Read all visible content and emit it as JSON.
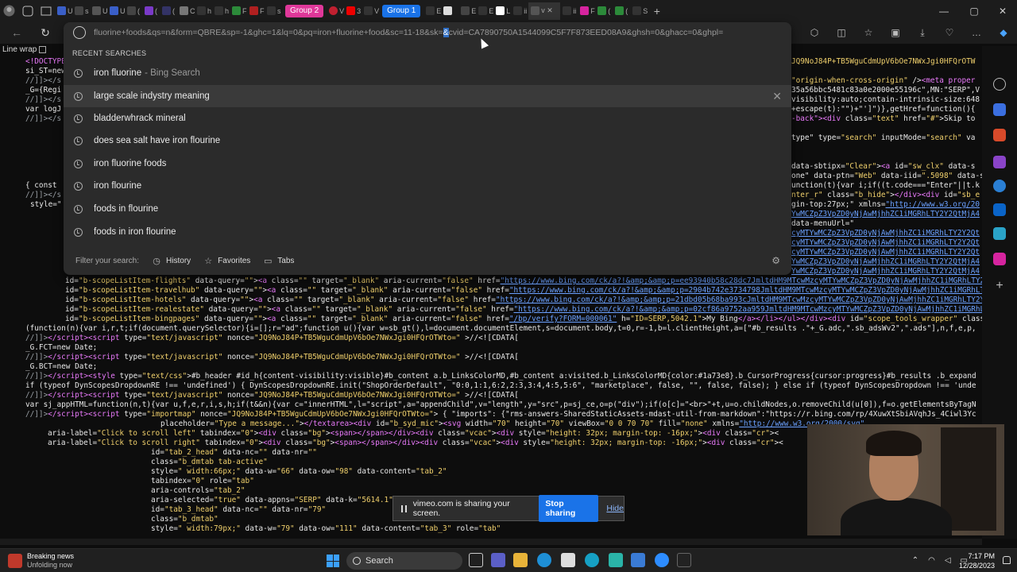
{
  "browser": {
    "tab_groups": [
      {
        "label": "Group 2",
        "color": "#e0389a"
      },
      {
        "label": "Group 1",
        "color": "#1a73e8"
      }
    ],
    "address_url": "fluorine+foods&qs=n&form=QBRE&sp=-1&ghc=1&lq=0&pq=iron+fluorine+food&sc=11-18&sk=",
    "address_url_selected": "&",
    "address_url_tail": "cvid=CA7890750A1544099C5F7F873EED08A9&ghsh=0&ghacc=0&ghpl="
  },
  "code_view": {
    "line_wrap_label": "Line wrap"
  },
  "omnibox": {
    "recent_heading": "RECENT SEARCHES",
    "suggestions": [
      {
        "text": "iron fluorine",
        "source": "- Bing Search"
      },
      {
        "text": "large scale indystry meaning",
        "source": ""
      },
      {
        "text": "bladderwhrack mineral",
        "source": ""
      },
      {
        "text": "does sea salt have iron flourine",
        "source": ""
      },
      {
        "text": "iron fluorine foods",
        "source": ""
      },
      {
        "text": "iron flourine",
        "source": ""
      },
      {
        "text": "foods in flourine",
        "source": ""
      },
      {
        "text": "foods in iron flourine",
        "source": ""
      }
    ],
    "filter_label": "Filter your search:",
    "filter_history": "History",
    "filter_favorites": "Favorites",
    "filter_tabs": "Tabs"
  },
  "share_banner": {
    "message": "vimeo.com is sharing your screen.",
    "stop_label": "Stop sharing",
    "hide_label": "Hide"
  },
  "taskbar": {
    "news_title": "Breaking news",
    "news_sub": "Unfolding now",
    "search_label": "Search",
    "time": "7:17 PM",
    "date": "12/28/2023"
  },
  "colors": {
    "tag": "#e879f9",
    "string": "#f0d06c",
    "link": "#6aa0ff",
    "accent": "#1a73e8"
  }
}
